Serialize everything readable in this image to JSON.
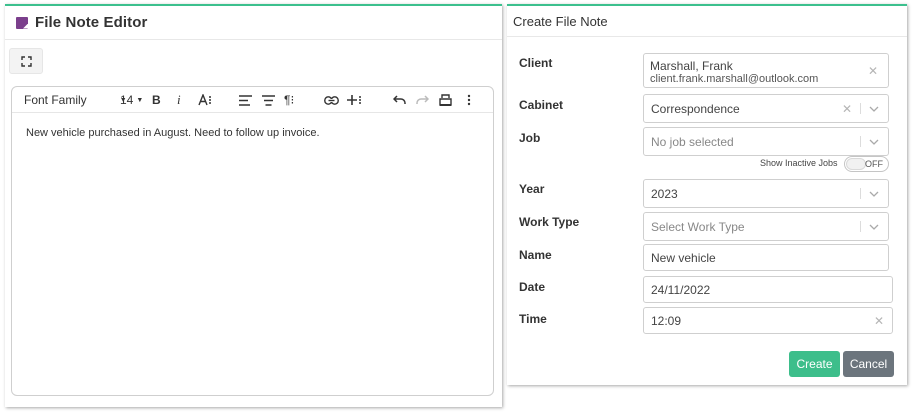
{
  "editor_panel": {
    "title": "File Note Editor",
    "toolbar": {
      "font_family": "Font Family",
      "font_size": "14"
    },
    "content": "New vehicle purchased in August. Need to follow up invoice."
  },
  "form": {
    "title": "Create File Note",
    "client": {
      "label": "Client",
      "name": "Marshall, Frank",
      "email": "client.frank.marshall@outlook.com"
    },
    "cabinet": {
      "label": "Cabinet",
      "value": "Correspondence"
    },
    "job": {
      "label": "Job",
      "placeholder": "No job selected"
    },
    "show_inactive": {
      "label": "Show Inactive Jobs",
      "state": "OFF"
    },
    "year": {
      "label": "Year",
      "value": "2023"
    },
    "work_type": {
      "label": "Work Type",
      "placeholder": "Select Work Type"
    },
    "name": {
      "label": "Name",
      "value": "New vehicle"
    },
    "date": {
      "label": "Date",
      "value": "24/11/2022"
    },
    "time": {
      "label": "Time",
      "value": "12:09"
    },
    "create_label": "Create",
    "cancel_label": "Cancel"
  },
  "colors": {
    "accent": "#3cc08e",
    "create_button": "#3dbe8b",
    "cancel_button": "#6c757d",
    "note_icon": "#7b3f8c"
  }
}
